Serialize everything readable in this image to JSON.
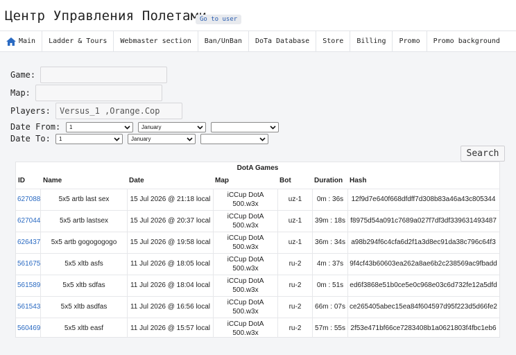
{
  "header": {
    "title": "Центр Управления Полетами",
    "goto_label": "Go to user"
  },
  "nav": {
    "items": [
      "Main",
      "Ladder & Tours",
      "Webmaster section",
      "Ban/UnBan",
      "DoTa Database",
      "Store",
      "Billing",
      "Promo",
      "Promo background"
    ]
  },
  "form": {
    "game_label": "Game:",
    "map_label": "Map:",
    "players_label": "Players:",
    "players_value": "Versus_1 ,Orange.Cop",
    "date_from_label": "Date From:",
    "date_to_label": "Date To:",
    "from_day": "1",
    "from_month": "January",
    "from_year": "",
    "to_day": "1",
    "to_month": "January",
    "to_year": "",
    "search_label": "Search"
  },
  "table": {
    "title": "DotA Games",
    "headers": [
      "ID",
      "Name",
      "Date",
      "Map",
      "Bot",
      "Duration",
      "Hash"
    ],
    "rows": [
      {
        "id": "627088",
        "name": "5x5 artb last sex",
        "date": "15 Jul 2026 @ 21:18 local",
        "map1": "iCCup DotA",
        "map2": "500.w3x",
        "bot": "uz-1",
        "duration": "0m : 36s",
        "hash": "12f9d7e640f668dfdff7d308b83a46a43c805344"
      },
      {
        "id": "627044",
        "name": "5x5 artb lastsex",
        "date": "15 Jul 2026 @ 20:37 local",
        "map1": "iCCup DotA",
        "map2": "500.w3x",
        "bot": "uz-1",
        "duration": "39m : 18s",
        "hash": "f8975d54a091c7689a027f7df3df339631493487"
      },
      {
        "id": "626437",
        "name": "5x5 artb gogogogogo",
        "date": "15 Jul 2026 @ 19:58 local",
        "map1": "iCCup DotA",
        "map2": "500.w3x",
        "bot": "uz-1",
        "duration": "36m : 34s",
        "hash": "a98b294f6c4cfa6d2f1a3d8ec91da38c796c64f3"
      },
      {
        "id": "561675",
        "name": "5x5 xltb asfs",
        "date": "11 Jul 2026 @ 18:05 local",
        "map1": "iCCup DotA",
        "map2": "500.w3x",
        "bot": "ru-2",
        "duration": "4m : 37s",
        "hash": "9f4cf43b60603ea262a8ae6b2c238569ac9fbadd"
      },
      {
        "id": "561589",
        "name": "5x5 xltb sdfas",
        "date": "11 Jul 2026 @ 18:04 local",
        "map1": "iCCup DotA",
        "map2": "500.w3x",
        "bot": "ru-2",
        "duration": "0m : 51s",
        "hash": "ed6f3868e51b0ce5e0c968e03c6d732fe12a5dfd"
      },
      {
        "id": "561543",
        "name": "5x5 xltb asdfas",
        "date": "11 Jul 2026 @ 16:56 local",
        "map1": "iCCup DotA",
        "map2": "500.w3x",
        "bot": "ru-2",
        "duration": "66m : 07s",
        "hash": "ce265405abec15ea84f604597d95f223d5d66fe2"
      },
      {
        "id": "560469",
        "name": "5x5 xltb easf",
        "date": "11 Jul 2026 @ 15:57 local",
        "map1": "iCCup DotA",
        "map2": "500.w3x",
        "bot": "ru-2",
        "duration": "57m : 55s",
        "hash": "2f53e471bf66ce7283408b1a0621803f4fbc1eb6"
      }
    ]
  }
}
